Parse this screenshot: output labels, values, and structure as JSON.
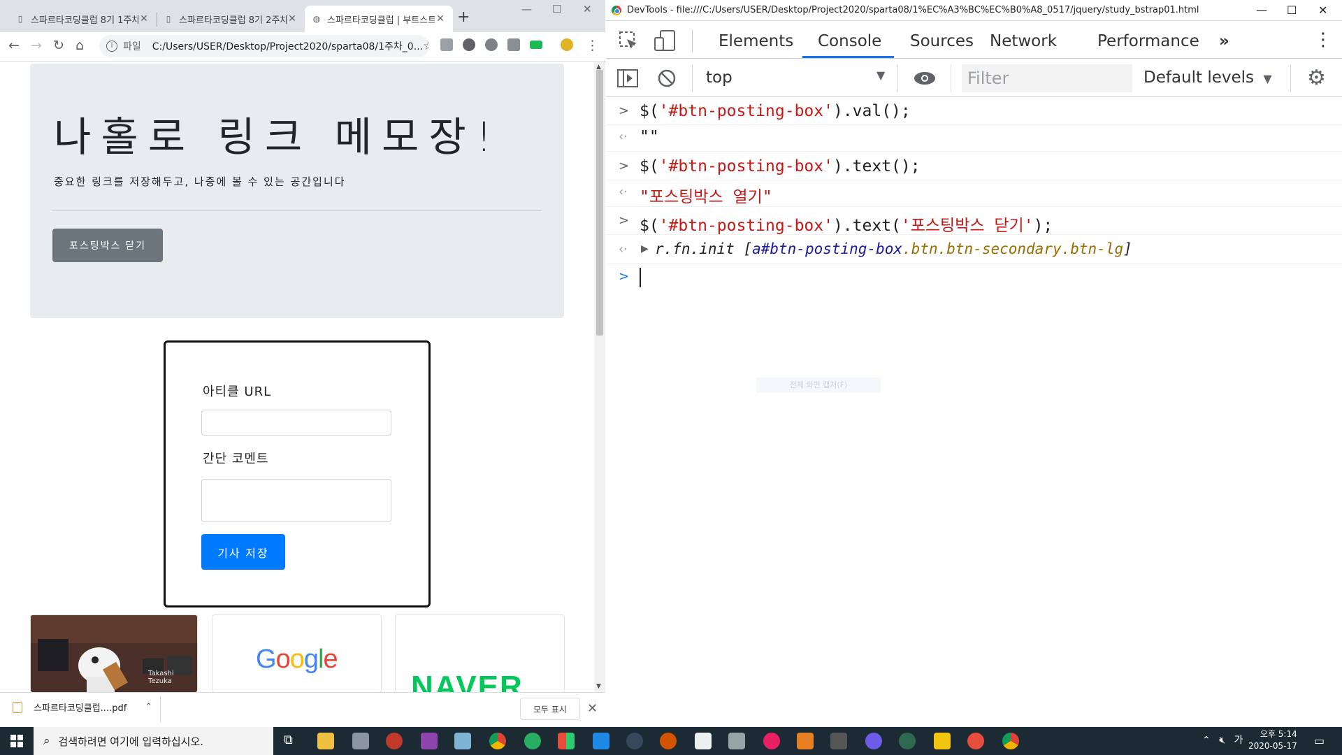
{
  "chrome": {
    "tabs": [
      {
        "title": "스파르타코딩클럽 8기 1주차"
      },
      {
        "title": "스파르타코딩클럽 8기 2주차"
      },
      {
        "title": "스파르타코딩클럽 | 부트스트랩"
      }
    ],
    "url_scheme": "파일",
    "url": "C:/Users/USER/Desktop/Project2020/sparta08/1주차_0..."
  },
  "page": {
    "title": "나홀로 링크 메모장!",
    "lead": "중요한 링크를 저장해두고, 나중에 볼 수 있는 공간입니다",
    "toggle_button": "포스팅박스 닫기",
    "url_label": "아티클 URL",
    "comment_label": "간단 코멘트",
    "save_button": "기사 저장",
    "card2_logo": "Google",
    "card3_logo": "NAVER",
    "card1_caption": "Takashi Tezuka"
  },
  "download": {
    "file": "스파르타코딩클럽....pdf",
    "show_all": "모두 표시"
  },
  "devtools": {
    "window_title": "DevTools - file:///C:/Users/USER/Desktop/Project2020/sparta08/1%EC%A3%BC%EC%B0%A8_0517/jquery/study_bstrap01.html",
    "tabs": [
      "Elements",
      "Console",
      "Sources",
      "Network",
      "Performance"
    ],
    "context": "top",
    "filter_placeholder": "Filter",
    "levels": "Default levels",
    "console": [
      {
        "in_pre": "$(",
        "in_str": "'#btn-posting-box'",
        "in_post": ").val();",
        "out": "\"\""
      },
      {
        "in_pre": "$(",
        "in_str": "'#btn-posting-box'",
        "in_post": ").text();",
        "out": "\"포스팅박스 열기\""
      },
      {
        "in_pre": "$(",
        "in_str": "'#btn-posting-box'",
        "in_mid": ").text(",
        "in_str2": "'포스팅박스 닫기'",
        "in_post": ");",
        "out_fn": "r.fn.init ",
        "out_open": "[",
        "out_sel": "a#btn-posting-box",
        "out_cls": ".btn.btn-secondary.btn-lg",
        "out_close": "]"
      }
    ],
    "ghost_tooltip": "전체 화면 캡처(F)"
  },
  "taskbar": {
    "search_placeholder": "검색하려면 여기에 입력하십시오.",
    "time": "오후 5:14",
    "date": "2020-05-17",
    "ime": "가"
  }
}
